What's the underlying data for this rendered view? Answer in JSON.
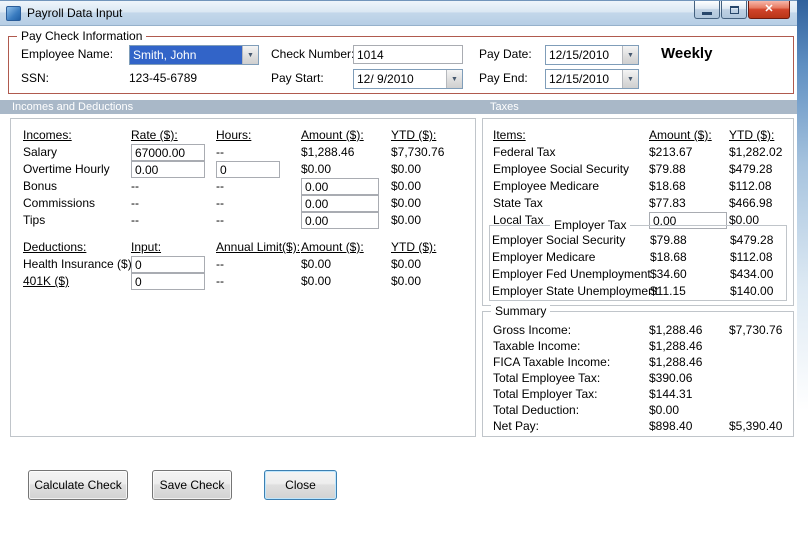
{
  "window": {
    "title": "Payroll Data Input"
  },
  "icons": {
    "dropdown": "▼",
    "close": "✕"
  },
  "colors": {
    "group_border": "#b05a4e",
    "section_bar": "#a9b8c8",
    "selection_highlight": "#3264c8",
    "close_button_red": "#d1442a"
  },
  "paycheck": {
    "group_title": "Pay Check Information",
    "employee_name_label": "Employee Name:",
    "employee_name_value": "Smith, John",
    "ssn_label": "SSN:",
    "ssn_value": "123-45-6789",
    "check_number_label": "Check Number:",
    "check_number_value": "1014",
    "pay_start_label": "Pay Start:",
    "pay_start_value": "12/ 9/2010",
    "pay_date_label": "Pay Date:",
    "pay_date_value": "12/15/2010",
    "pay_end_label": "Pay End:",
    "pay_end_value": "12/15/2010",
    "frequency": "Weekly"
  },
  "section_headers": {
    "incomes_deductions": "Incomes and Deductions",
    "taxes": "Taxes"
  },
  "incomes": {
    "headers": {
      "name": "Incomes:",
      "rate": "Rate ($):",
      "hours": "Hours:",
      "amount": "Amount ($):",
      "ytd": "YTD ($):"
    },
    "rows": [
      {
        "name": "Salary",
        "rate": "67000.00",
        "hours": "--",
        "amount": "$1,288.46",
        "ytd": "$7,730.76"
      },
      {
        "name": "Overtime Hourly",
        "rate": "0.00",
        "hours": "0",
        "amount": "$0.00",
        "ytd": "$0.00"
      },
      {
        "name": "Bonus",
        "rate": "--",
        "hours": "--",
        "amount": "0.00",
        "ytd": "$0.00"
      },
      {
        "name": "Commissions",
        "rate": "--",
        "hours": "--",
        "amount": "0.00",
        "ytd": "$0.00"
      },
      {
        "name": "Tips",
        "rate": "--",
        "hours": "--",
        "amount": "0.00",
        "ytd": "$0.00"
      }
    ]
  },
  "deductions": {
    "headers": {
      "name": "Deductions:",
      "input": "Input:",
      "annual_limit": "Annual Limit($):",
      "amount": "Amount ($):",
      "ytd": "YTD ($):"
    },
    "rows": [
      {
        "name": "Health Insurance ($)",
        "input": "0",
        "annual_limit": "--",
        "amount": "$0.00",
        "ytd": "$0.00"
      },
      {
        "name": "401K ($)",
        "input": "0",
        "annual_limit": "--",
        "amount": "$0.00",
        "ytd": "$0.00"
      }
    ]
  },
  "taxes": {
    "headers": {
      "items": "Items:",
      "amount": "Amount ($):",
      "ytd": "YTD ($):"
    },
    "rows": [
      {
        "name": "Federal Tax",
        "amount": "$213.67",
        "ytd": "$1,282.02"
      },
      {
        "name": "Employee Social Security",
        "amount": "$79.88",
        "ytd": "$479.28"
      },
      {
        "name": "Employee Medicare",
        "amount": "$18.68",
        "ytd": "$112.08"
      },
      {
        "name": "State Tax",
        "amount": "$77.83",
        "ytd": "$466.98"
      },
      {
        "name": "Local Tax",
        "amount": "0.00",
        "ytd": "$0.00"
      }
    ],
    "employer_group_title": "Employer Tax",
    "employer_rows": [
      {
        "name": "Employer Social Security",
        "amount": "$79.88",
        "ytd": "$479.28"
      },
      {
        "name": "Employer Medicare",
        "amount": "$18.68",
        "ytd": "$112.08"
      },
      {
        "name": "Employer Fed Unemployment",
        "amount": "$34.60",
        "ytd": "$434.00"
      },
      {
        "name": "Employer State Unemployment",
        "amount": "$11.15",
        "ytd": "$140.00"
      }
    ]
  },
  "summary": {
    "group_title": "Summary",
    "rows": [
      {
        "name": "Gross Income:",
        "amount": "$1,288.46",
        "ytd": "$7,730.76"
      },
      {
        "name": "Taxable Income:",
        "amount": "$1,288.46",
        "ytd": ""
      },
      {
        "name": "FICA Taxable Income:",
        "amount": "$1,288.46",
        "ytd": ""
      },
      {
        "name": "Total Employee Tax:",
        "amount": "$390.06",
        "ytd": ""
      },
      {
        "name": "Total Employer Tax:",
        "amount": "$144.31",
        "ytd": ""
      },
      {
        "name": "Total Deduction:",
        "amount": "$0.00",
        "ytd": ""
      },
      {
        "name": "Net Pay:",
        "amount": "$898.40",
        "ytd": "$5,390.40"
      }
    ]
  },
  "buttons": {
    "calculate": "Calculate Check",
    "save": "Save Check",
    "close": "Close"
  }
}
